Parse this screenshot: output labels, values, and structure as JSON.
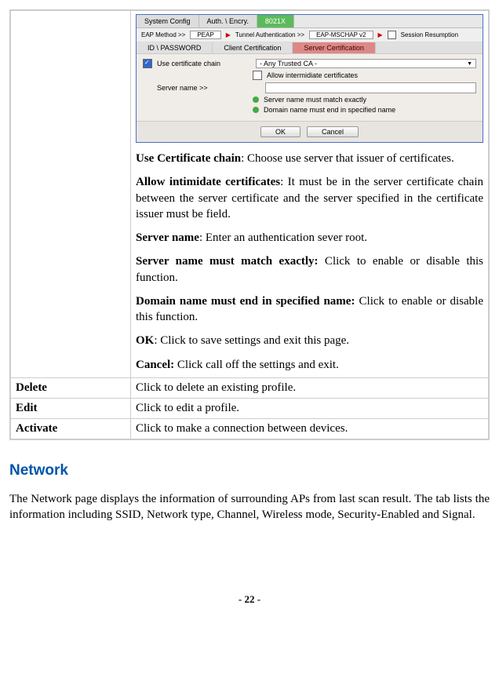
{
  "screenshot": {
    "tabs": {
      "system_config": "System Config",
      "auth_encry": "Auth. \\ Encry.",
      "x8021": "8021X"
    },
    "method_row": {
      "eap_method_label": "EAP Method >>",
      "eap_method_value": "PEAP",
      "tunnel_auth_label": "Tunnel Authentication >>",
      "tunnel_auth_value": "EAP-MSCHAP v2",
      "session_resumption": "Session Resumption"
    },
    "sub_tabs": {
      "id_password": "ID \\ PASSWORD",
      "client_cert": "Client Certification",
      "server_cert": "Server Certification"
    },
    "form": {
      "use_cert_chain": "Use certificate chain",
      "any_trusted_ca": "- Any Trusted CA -",
      "allow_intermediate": "Allow intermidiate certificates",
      "server_name_label": "Server name >>",
      "server_name_match": "Server name must match exactly",
      "domain_name_end": "Domain name must end in specified name"
    },
    "buttons": {
      "ok": "OK",
      "cancel": "Cancel"
    }
  },
  "descriptions": {
    "use_cert_chain": {
      "label": "Use Certificate chain",
      "text": ": Choose use server that issuer of certificates."
    },
    "allow_intimidate": {
      "label": "Allow intimidate certificates",
      "text": ": It must be in the server certificate chain between the server certificate and the server specified in the certificate issuer must be field."
    },
    "server_name": {
      "label": "Server name",
      "text": ": Enter an authentication sever root."
    },
    "server_name_match": {
      "label": "Server name must match exactly:",
      "text": " Click to enable or disable this function."
    },
    "domain_name_end": {
      "label": "Domain name must end in specified name:",
      "text": " Click to enable or disable this function."
    },
    "ok": {
      "label": "OK",
      "text": ": Click to save settings and exit this page."
    },
    "cancel": {
      "label": "Cancel:",
      "text": " Click call off the settings and exit."
    }
  },
  "table_rows": {
    "delete": {
      "label": "Delete",
      "desc": "Click to delete an existing profile."
    },
    "edit": {
      "label": "Edit",
      "desc": "Click to edit a profile."
    },
    "activate": {
      "label": "Activate",
      "desc": "Click to make a connection between devices."
    }
  },
  "network": {
    "heading": "Network",
    "body": "The Network page displays the information of surrounding APs from last scan result. The tab lists the information including SSID, Network type, Channel, Wireless mode, Security-Enabled and Signal."
  },
  "page_number": "- 22 -"
}
